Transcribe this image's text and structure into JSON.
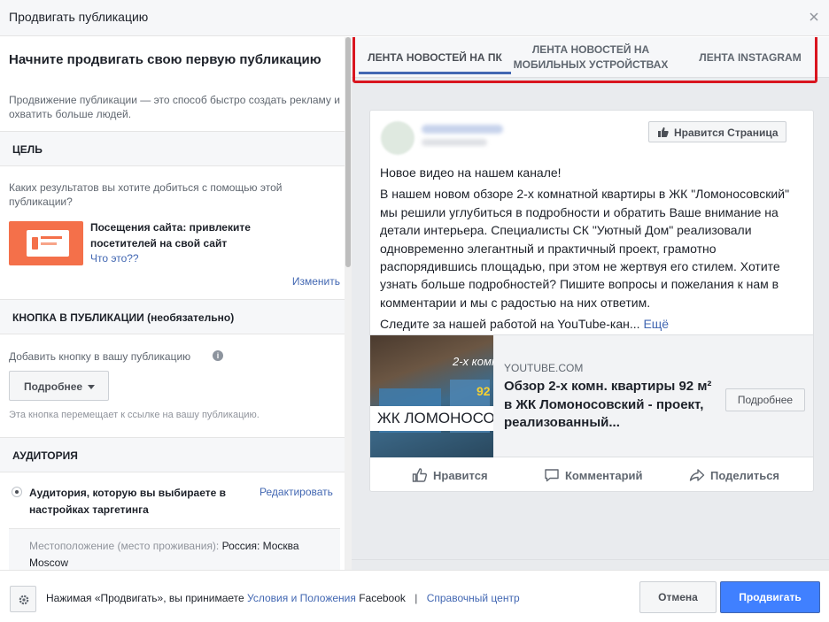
{
  "dialog": {
    "title": "Продвигать публикацию"
  },
  "left": {
    "intro_title": "Начните продвигать свою первую публикацию",
    "intro_desc": "Продвижение публикации — это способ быстро создать рекламу и охватить больше людей.",
    "goal": {
      "section_title": "ЦЕЛЬ",
      "question": "Каких результатов вы хотите добиться с помощью этой публикации?",
      "option_title": "Посещения сайта: привлеките посетителей на свой сайт",
      "what_link": "Что это??",
      "change_link": "Изменить"
    },
    "button_section": {
      "section_title": "КНОПКА В ПУБЛИКАЦИИ (необязательно)",
      "label": "Добавить кнопку в вашу публикацию",
      "dropdown_value": "Подробнее",
      "hint": "Эта кнопка перемещает к ссылке на вашу публикацию."
    },
    "audience": {
      "section_title": "АУДИТОРИЯ",
      "option": "Аудитория, которую вы выбираете в настройках таргетинга",
      "edit_link": "Редактировать",
      "location_label": "Местоположение (место проживания):",
      "location_value": "Россия: Москва Moscow"
    }
  },
  "tabs": [
    {
      "label": "ЛЕНТА НОВОСТЕЙ НА ПК",
      "active": true
    },
    {
      "label": "ЛЕНТА НОВОСТЕЙ НА МОБИЛЬНЫХ УСТРОЙСТВАХ",
      "active": false
    },
    {
      "label": "ЛЕНТА INSTAGRAM",
      "active": false
    }
  ],
  "post": {
    "like_page_button": "Нравится Страница",
    "paragraph1": "Новое видео на нашем канале!",
    "paragraph2": "В нашем новом обзоре 2-х комнатной квартиры в ЖК \"Ломоносовский\" мы решили углубиться в подробности и обратить Ваше внимание на детали интерьера. Специалисты СК \"Уютный Дом\" реализовали одновременно элегантный и практичный проект, грамотно распорядившись площадью, при этом не жертвуя его стилем. Хотите узнать больше подробностей? Пишите вопросы и пожелания к нам в комментарии и мы с радостью на них ответим.",
    "paragraph3": "Следите за нашей работой на YouTube-кан...",
    "more_link": "Ещё",
    "link": {
      "image_text_top": "2-х комн",
      "image_text_mid": "92",
      "image_text_band": "ЖК ЛОМОНОСОВСК",
      "domain": "YOUTUBE.COM",
      "title": "Обзор 2-х комн. квартиры 92 м² в ЖК Ломоносовский - проект, реализованный...",
      "button": "Подробнее"
    },
    "actions": {
      "like": "Нравится",
      "comment": "Комментарий",
      "share": "Поделиться"
    }
  },
  "footer": {
    "text_prefix": "Нажимая «Продвигать», вы принимаете",
    "terms_link": "Условия и Положения",
    "text_brand": "Facebook",
    "separator": "|",
    "help_link": "Справочный центр",
    "cancel": "Отмена",
    "promote": "Продвигать"
  },
  "colors": {
    "accent": "#4267b2",
    "primary_button": "#4080ff",
    "highlight_frame": "#d9151f"
  }
}
